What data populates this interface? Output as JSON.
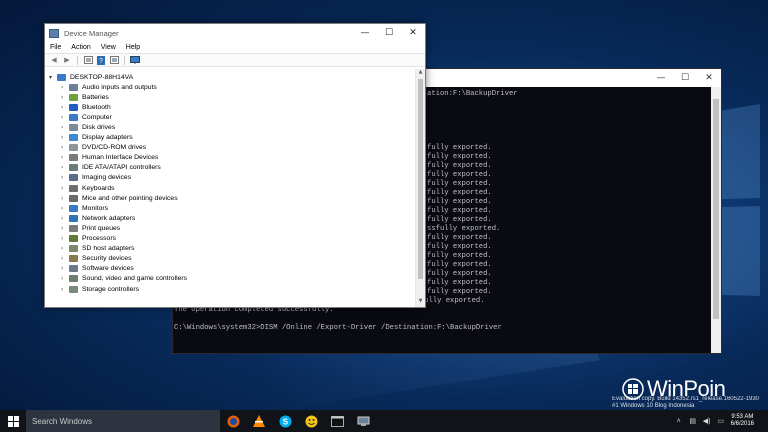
{
  "device_manager": {
    "title": "Device Manager",
    "controls": {
      "minimize": "—",
      "maximize": "☐",
      "close": "✕"
    },
    "menu": [
      "File",
      "Action",
      "View",
      "Help"
    ],
    "toolbar_icons": [
      "back-icon",
      "forward-icon",
      "properties-icon",
      "help-icon",
      "view-icon",
      "monitor-icon"
    ],
    "root": "DESKTOP-88H14VA",
    "categories": [
      {
        "label": "Audio inputs and outputs",
        "color": "#6b7f99"
      },
      {
        "label": "Batteries",
        "color": "#6fa23a"
      },
      {
        "label": "Bluetooth",
        "color": "#1f5fbf"
      },
      {
        "label": "Computer",
        "color": "#3a7ac8"
      },
      {
        "label": "Disk drives",
        "color": "#7f8a95"
      },
      {
        "label": "Display adapters",
        "color": "#3d8ad0"
      },
      {
        "label": "DVD/CD-ROM drives",
        "color": "#8e949a"
      },
      {
        "label": "Human Interface Devices",
        "color": "#7b7b7b"
      },
      {
        "label": "IDE ATA/ATAPI controllers",
        "color": "#6a7d7a"
      },
      {
        "label": "Imaging devices",
        "color": "#5a6e8a"
      },
      {
        "label": "Keyboards",
        "color": "#6e6e6e"
      },
      {
        "label": "Mice and other pointing devices",
        "color": "#6a6a6a"
      },
      {
        "label": "Monitors",
        "color": "#3a7ac8"
      },
      {
        "label": "Network adapters",
        "color": "#2f74b5"
      },
      {
        "label": "Print queues",
        "color": "#7a7a7a"
      },
      {
        "label": "Processors",
        "color": "#5f7a3a"
      },
      {
        "label": "SD host adapters",
        "color": "#7a8a6a"
      },
      {
        "label": "Security devices",
        "color": "#8a7a4a"
      },
      {
        "label": "Software devices",
        "color": "#6a7a8a"
      },
      {
        "label": "Sound, video and game controllers",
        "color": "#6f7f6f"
      },
      {
        "label": "Storage controllers",
        "color": "#7a8a7a"
      }
    ]
  },
  "cmd": {
    "controls": {
      "minimize": "—",
      "maximize": "☐",
      "close": "✕"
    },
    "lines": [
      "",
      "",
      "",
      "",
      "                                                                                  ",
      "",
      "",
      "",
      "                                        ",
      "",
      "",
      "",
      "",
      "",
      "",
      "",
      "",
      "",
      "",
      "",
      "",
      "",
      "",
      "Exporting 18 of 18 - oem9.inf: The driver package successfully exported.",
      "The operation completed successfully.",
      "",
      "C:\\Windows\\system32>DISM /Online /Export-Driver /Destination:F:\\BackupDriver"
    ],
    "visible_right": [
      {
        "text": "ation:F:\\BackupDriver",
        "row": 0
      },
      {
        "text": "fully exported.",
        "row": 6
      },
      {
        "text": "fully exported.",
        "row": 7
      },
      {
        "text": "fully exported.",
        "row": 8
      },
      {
        "text": "fully exported.",
        "row": 9
      },
      {
        "text": "fully exported.",
        "row": 10
      },
      {
        "text": "fully exported.",
        "row": 11
      },
      {
        "text": "fully exported.",
        "row": 12
      },
      {
        "text": "fully exported.",
        "row": 13
      },
      {
        "text": "fully exported.",
        "row": 14
      },
      {
        "text": "ssfully exported.",
        "row": 15
      },
      {
        "text": "fully exported.",
        "row": 16
      },
      {
        "text": "fully exported.",
        "row": 17
      },
      {
        "text": "fully exported.",
        "row": 18
      },
      {
        "text": "fully exported.",
        "row": 19
      },
      {
        "text": "fully exported.",
        "row": 20
      },
      {
        "text": "fully exported.",
        "row": 21
      },
      {
        "text": "fully exported.",
        "row": 22
      }
    ]
  },
  "taskbar": {
    "search_placeholder": "Search Windows",
    "apps": [
      "firefox-icon",
      "vlc-icon",
      "skype-icon",
      "emoji-app-icon",
      "terminal-icon",
      "device-manager-icon"
    ],
    "clock_time": "9:53 AM",
    "clock_date": "6/6/2016"
  },
  "watermark": {
    "line1": "Evaluation copy. Build 14352.rs1_release.160522-1930",
    "line2": "#1 Windows 10 Blog Indonesia"
  },
  "brand": {
    "name": "WinPoin"
  }
}
